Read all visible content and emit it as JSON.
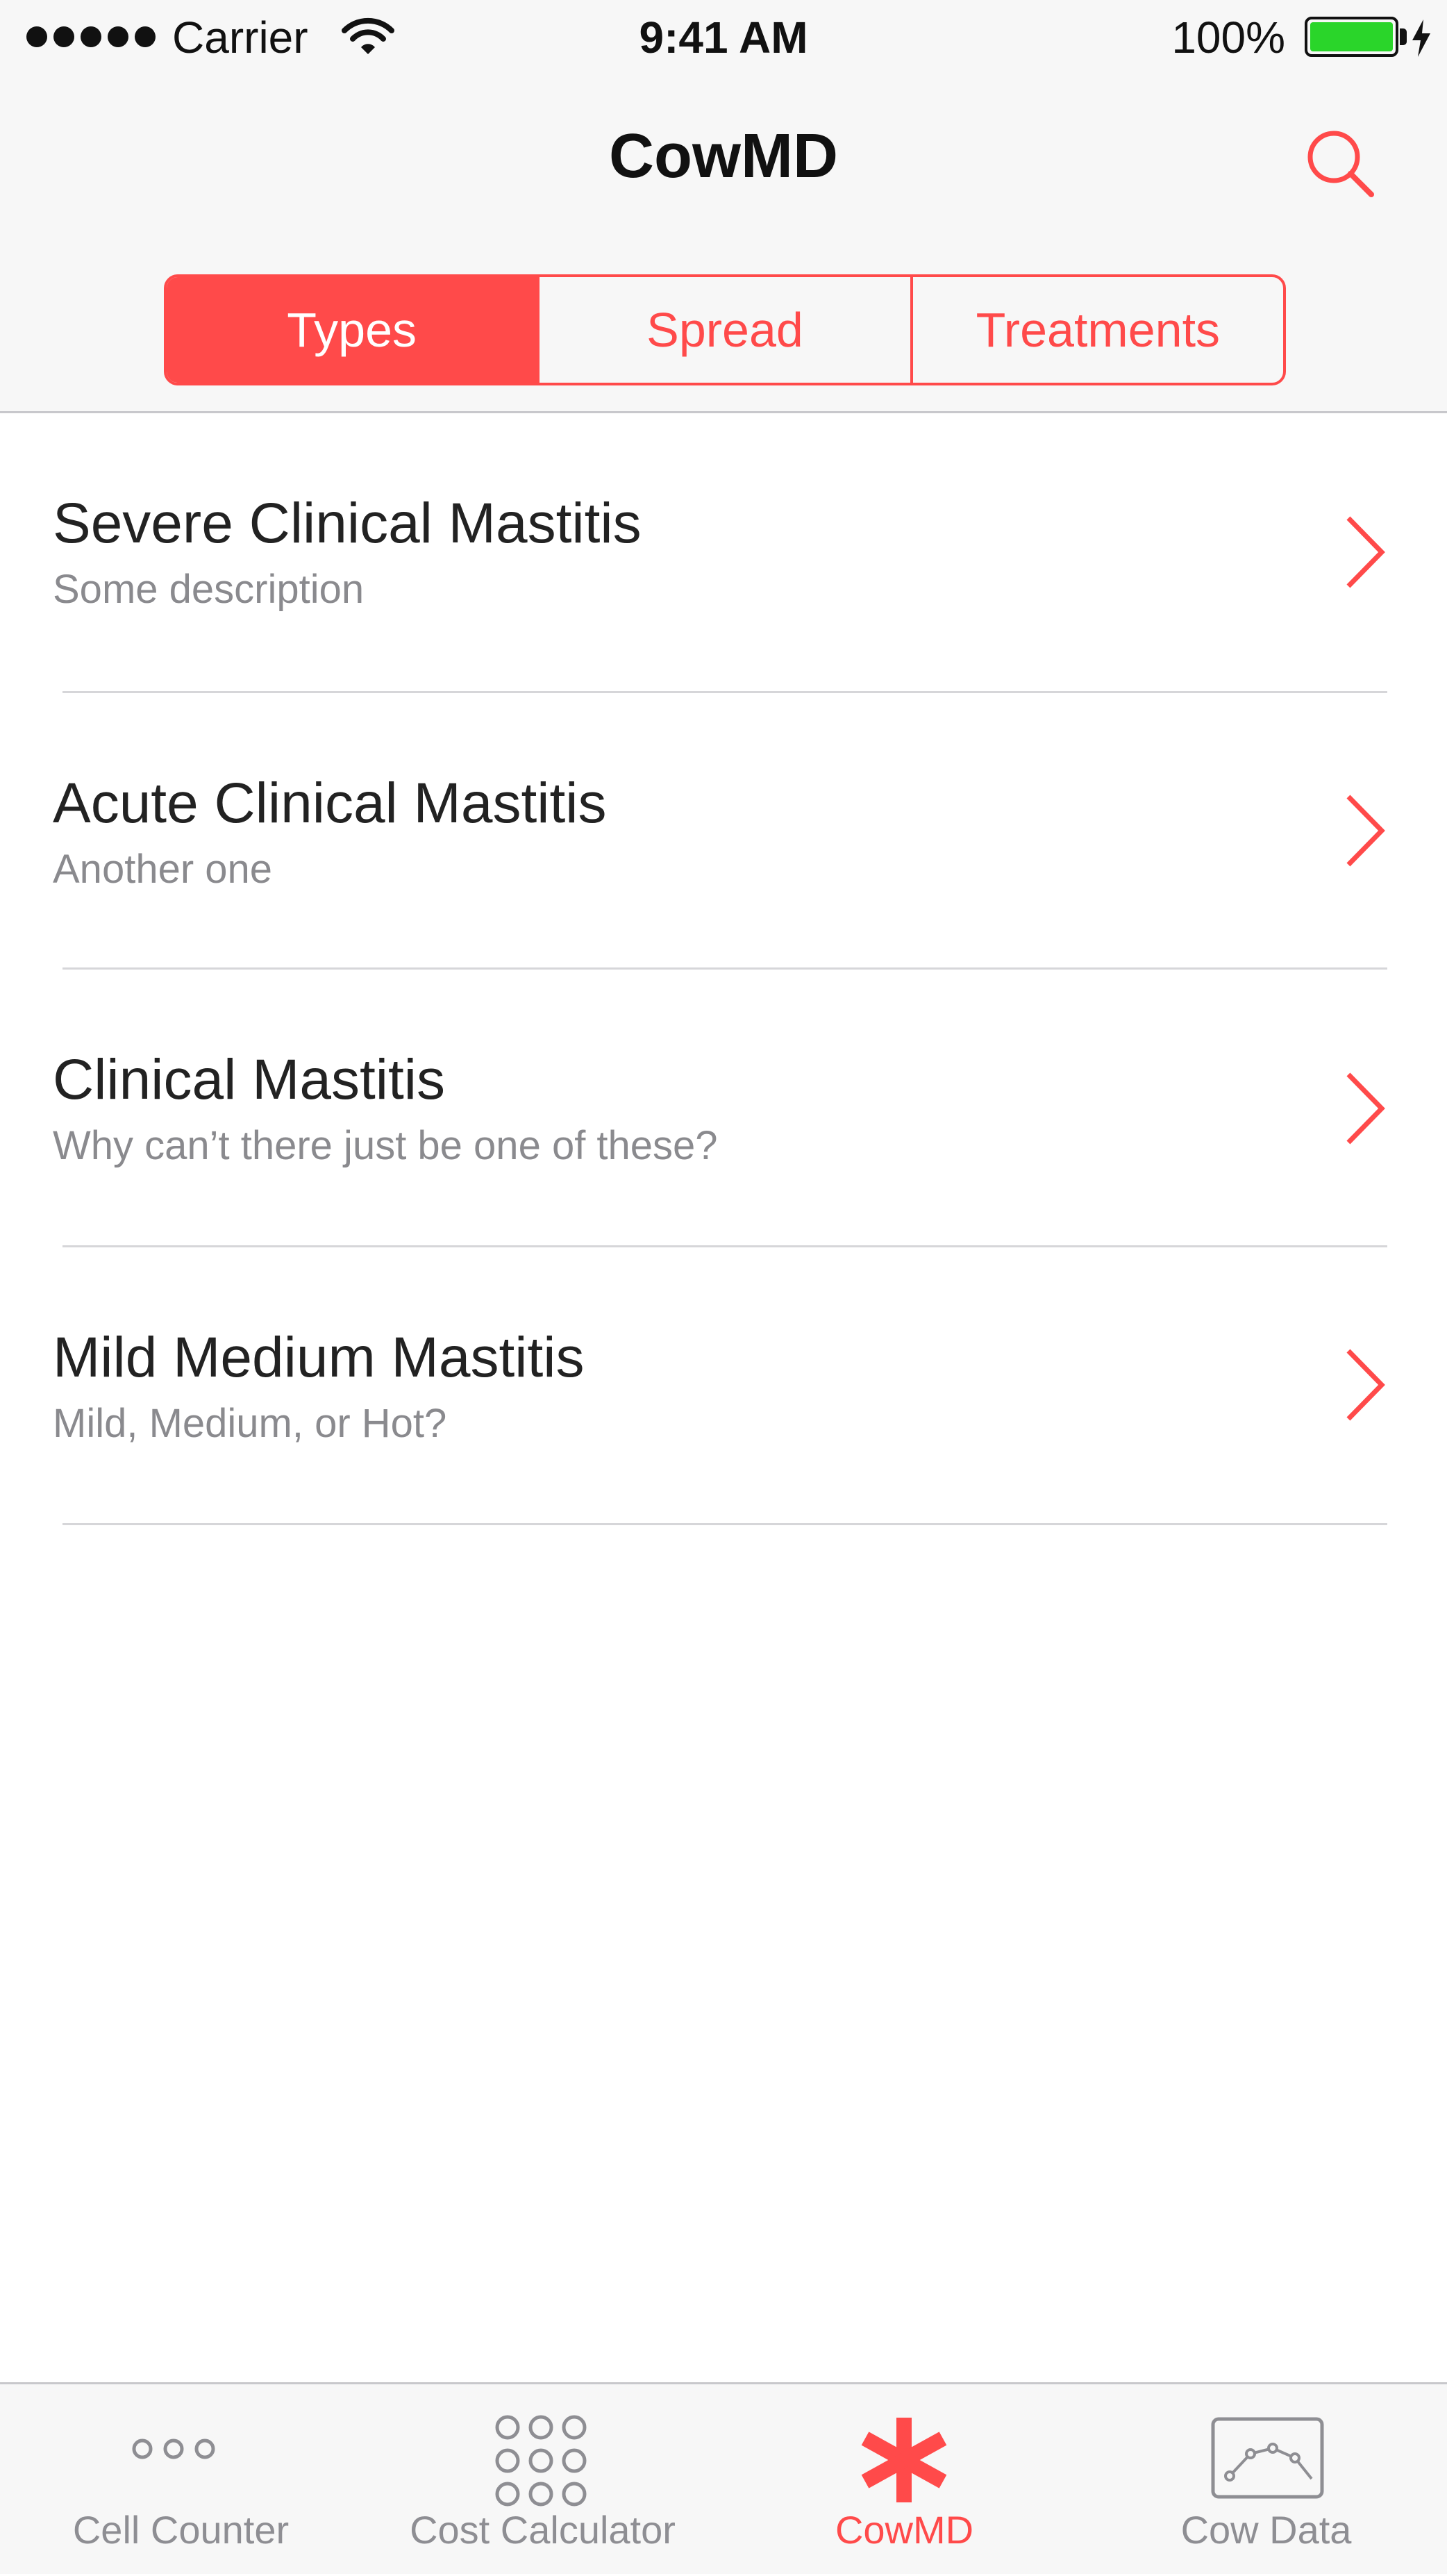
{
  "status_bar": {
    "carrier": "Carrier",
    "time": "9:41 AM",
    "battery": "100%"
  },
  "nav": {
    "title": "CowMD",
    "search_icon": "search-icon"
  },
  "segments": [
    {
      "label": "Types",
      "selected": true
    },
    {
      "label": "Spread",
      "selected": false
    },
    {
      "label": "Treatments",
      "selected": false
    }
  ],
  "list": [
    {
      "title": "Severe Clinical Mastitis",
      "subtitle": "Some description"
    },
    {
      "title": "Acute Clinical Mastitis",
      "subtitle": "Another one"
    },
    {
      "title": "Clinical Mastitis",
      "subtitle": "Why can’t there just be one of these?"
    },
    {
      "title": "Mild Medium Mastitis",
      "subtitle": "Mild, Medium, or Hot?"
    }
  ],
  "tabs": [
    {
      "label": "Cell Counter",
      "icon": "three-dots-icon",
      "selected": false
    },
    {
      "label": "Cost Calculator",
      "icon": "dot-grid-icon",
      "selected": false
    },
    {
      "label": "CowMD",
      "icon": "asterisk-icon",
      "selected": true
    },
    {
      "label": "Cow Data",
      "icon": "line-chart-icon",
      "selected": false
    }
  ],
  "colors": {
    "accent": "#ff4a4a",
    "inactive": "#8e8e93",
    "battery": "#2ad52a"
  }
}
